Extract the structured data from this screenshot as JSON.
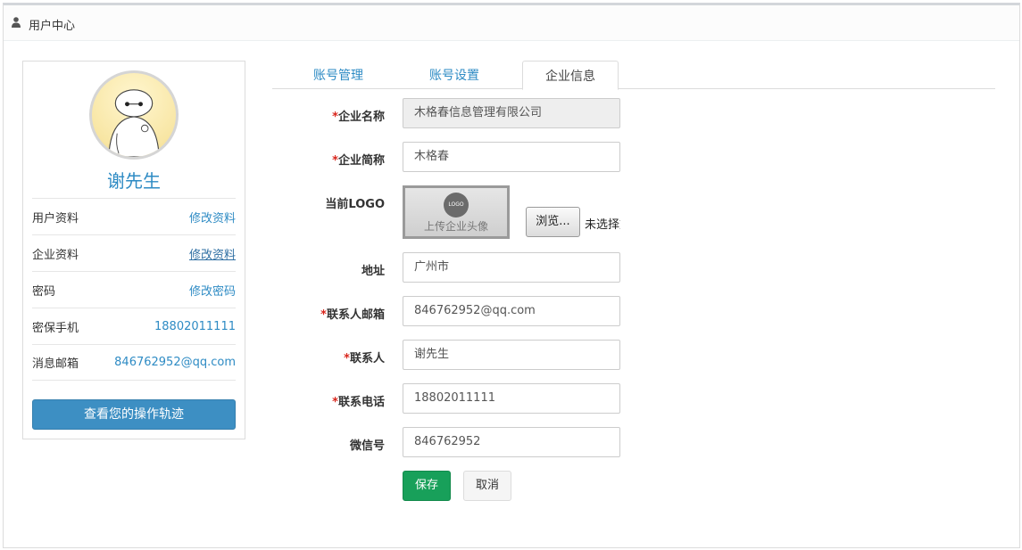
{
  "header": {
    "title": "用户中心",
    "icon": "user-icon"
  },
  "profile": {
    "name": "谢先生",
    "rows": [
      {
        "label": "用户资料",
        "value": "修改资料"
      },
      {
        "label": "企业资料",
        "value": "修改资料"
      },
      {
        "label": "密码",
        "value": "修改密码"
      },
      {
        "label": "密保手机",
        "value": "18802011111"
      },
      {
        "label": "消息邮箱",
        "value": "846762952@qq.com"
      }
    ],
    "track_button": "查看您的操作轨迹"
  },
  "tabs": [
    {
      "label": "账号管理"
    },
    {
      "label": "账号设置"
    },
    {
      "label": "企业信息"
    }
  ],
  "form": {
    "required_mark": "*",
    "company_name": {
      "label": "企业名称",
      "value": "木格春信息管理有限公司"
    },
    "company_short": {
      "label": "企业简称",
      "value": "木格春"
    },
    "logo": {
      "label": "当前LOGO",
      "badge": "LOGO",
      "caption": "上传企业头像",
      "browse": "浏览...",
      "no_file": "未选择文件。"
    },
    "address": {
      "label": "地址",
      "value": "广州市"
    },
    "email": {
      "label": "联系人邮箱",
      "value": "846762952@qq.com"
    },
    "contact": {
      "label": "联系人",
      "value": "谢先生"
    },
    "phone": {
      "label": "联系电话",
      "value": "18802011111"
    },
    "wechat": {
      "label": "微信号",
      "value": "846762952"
    },
    "save": "保存",
    "cancel": "取消"
  },
  "colors": {
    "link": "#2e8bc4",
    "primary_button": "#3d8fc3",
    "save_button": "#18a05a",
    "required": "#d9261c"
  }
}
